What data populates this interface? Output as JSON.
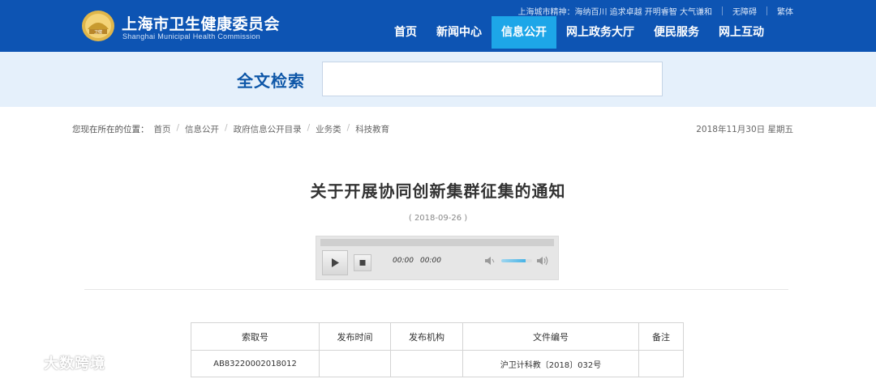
{
  "header": {
    "site_title_cn": "上海市卫生健康委员会",
    "site_title_en": "Shanghai Municipal Health Commission",
    "emblem_text": "卫健",
    "slogan": "上海城市精神：海纳百川 追求卓越 开明睿智 大气谦和",
    "accessibility_link": "无障碍",
    "traditional_link": "繁体",
    "nav": [
      {
        "label": "首页"
      },
      {
        "label": "新闻中心"
      },
      {
        "label": "信息公开",
        "active": true
      },
      {
        "label": "网上政务大厅"
      },
      {
        "label": "便民服务"
      },
      {
        "label": "网上互动"
      }
    ],
    "colors": {
      "header_bg": "#0d54b3",
      "nav_active_bg": "#1da6e8"
    }
  },
  "search": {
    "label": "全文检索",
    "value": ""
  },
  "breadcrumb": {
    "prefix": "您现在所在的位置：",
    "items": [
      "首页",
      "信息公开",
      "政府信息公开目录",
      "业务类",
      "科技教育"
    ]
  },
  "current_date": "2018年11月30日 星期五",
  "article": {
    "title": "关于开展协同创新集群征集的通知",
    "date": "( 2018-09-26 )"
  },
  "audio_player": {
    "current_time": "00:00",
    "duration": "00:00",
    "progress": 0,
    "volume": 0.8,
    "play_icon": "play-icon",
    "stop_icon": "stop-icon",
    "mute_icon": "volume-mute-icon",
    "volume_icon": "volume-max-icon"
  },
  "info_table": {
    "headers": [
      "索取号",
      "发布时间",
      "发布机构",
      "文件编号",
      "备注"
    ],
    "rows": [
      [
        "AB83220002018012",
        "",
        "",
        "沪卫计科教〔2018〕032号",
        ""
      ]
    ]
  },
  "watermark": {
    "text": "大数跨境"
  }
}
